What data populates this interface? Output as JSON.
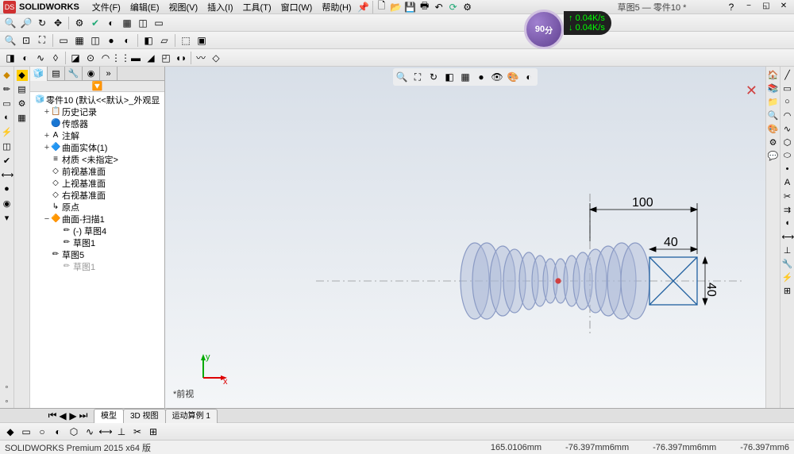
{
  "app_name": "SOLIDWORKS",
  "menus": [
    "文件(F)",
    "编辑(E)",
    "视图(V)",
    "插入(I)",
    "工具(T)",
    "窗口(W)",
    "帮助(H)"
  ],
  "doc_title": "草图5 — 零件10 *",
  "badge": {
    "score": "90",
    "unit": "分",
    "net_up": "0.04K/s",
    "net_down": "0.04K/s"
  },
  "tree": {
    "root": "零件10 (默认<<默认>_外观显",
    "nodes": [
      {
        "icon": "📋",
        "label": "历史记录",
        "d": 1,
        "exp": "+"
      },
      {
        "icon": "🔵",
        "label": "传感器",
        "d": 1,
        "exp": ""
      },
      {
        "icon": "A",
        "label": "注解",
        "d": 1,
        "exp": "+"
      },
      {
        "icon": "🔷",
        "label": "曲面实体(1)",
        "d": 1,
        "exp": "+"
      },
      {
        "icon": "≡",
        "label": "材质 <未指定>",
        "d": 1,
        "exp": ""
      },
      {
        "icon": "◇",
        "label": "前视基准面",
        "d": 1,
        "exp": ""
      },
      {
        "icon": "◇",
        "label": "上视基准面",
        "d": 1,
        "exp": ""
      },
      {
        "icon": "◇",
        "label": "右视基准面",
        "d": 1,
        "exp": ""
      },
      {
        "icon": "↳",
        "label": "原点",
        "d": 1,
        "exp": ""
      },
      {
        "icon": "🔶",
        "label": "曲面-扫描1",
        "d": 1,
        "exp": "−"
      },
      {
        "icon": "✏",
        "label": "(-) 草图4",
        "d": 2,
        "exp": ""
      },
      {
        "icon": "✏",
        "label": "草图1",
        "d": 2,
        "exp": ""
      },
      {
        "icon": "✏",
        "label": "草图5",
        "d": 1,
        "exp": ""
      },
      {
        "icon": "✏",
        "label": "草图1",
        "d": 2,
        "exp": "",
        "dim": true
      }
    ]
  },
  "dimensions": {
    "d100": "100",
    "d40": "40",
    "d40v": "40"
  },
  "bottom_tabs": [
    "模型",
    "3D 视图",
    "运动算例 1"
  ],
  "view_label": "*前视",
  "status": {
    "product": "SOLIDWORKS Premium 2015 x64 版",
    "coord1": "165.0106mm",
    "coord2": "-76.397mm",
    "coord3": "-76.397mm",
    "coord4": "-76.397mm",
    "unit2": "6mm",
    "unit3": "6mm",
    "unit4": "6"
  },
  "axes": {
    "x": "x",
    "y": "y"
  }
}
